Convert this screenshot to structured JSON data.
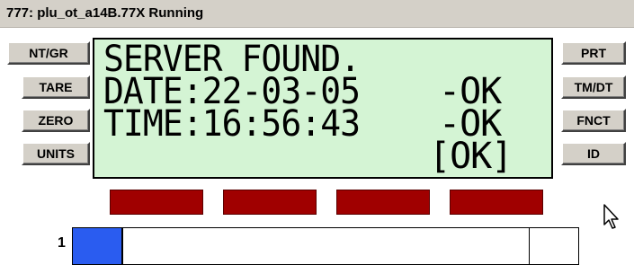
{
  "window": {
    "title": "777: plu_ot_a14B.77X Running",
    "background": "#ffffff",
    "titlebar_color": "#d4d0c8"
  },
  "left_buttons": [
    {
      "label": "NT/GR"
    },
    {
      "label": "TARE"
    },
    {
      "label": "ZERO"
    },
    {
      "label": "UNITS"
    }
  ],
  "right_buttons": [
    {
      "label": "PRT"
    },
    {
      "label": "TM/DT"
    },
    {
      "label": "FNCT"
    },
    {
      "label": "ID"
    }
  ],
  "display": {
    "background": "#d4f4d4",
    "line1": "SERVER FOUND.",
    "line2": "DATE:22-03-05",
    "line2_status": "-OK",
    "line3": "TIME:16:56:43",
    "line3_status": "-OK",
    "line4_status": "[OK]"
  },
  "indicators": {
    "count": 4,
    "color": "#a00000"
  },
  "progress": {
    "channel_label": "1",
    "fill_fraction": 0.1,
    "fill_color": "#2a5cf0"
  },
  "cursor": {
    "icon": "mouse-pointer-icon"
  }
}
